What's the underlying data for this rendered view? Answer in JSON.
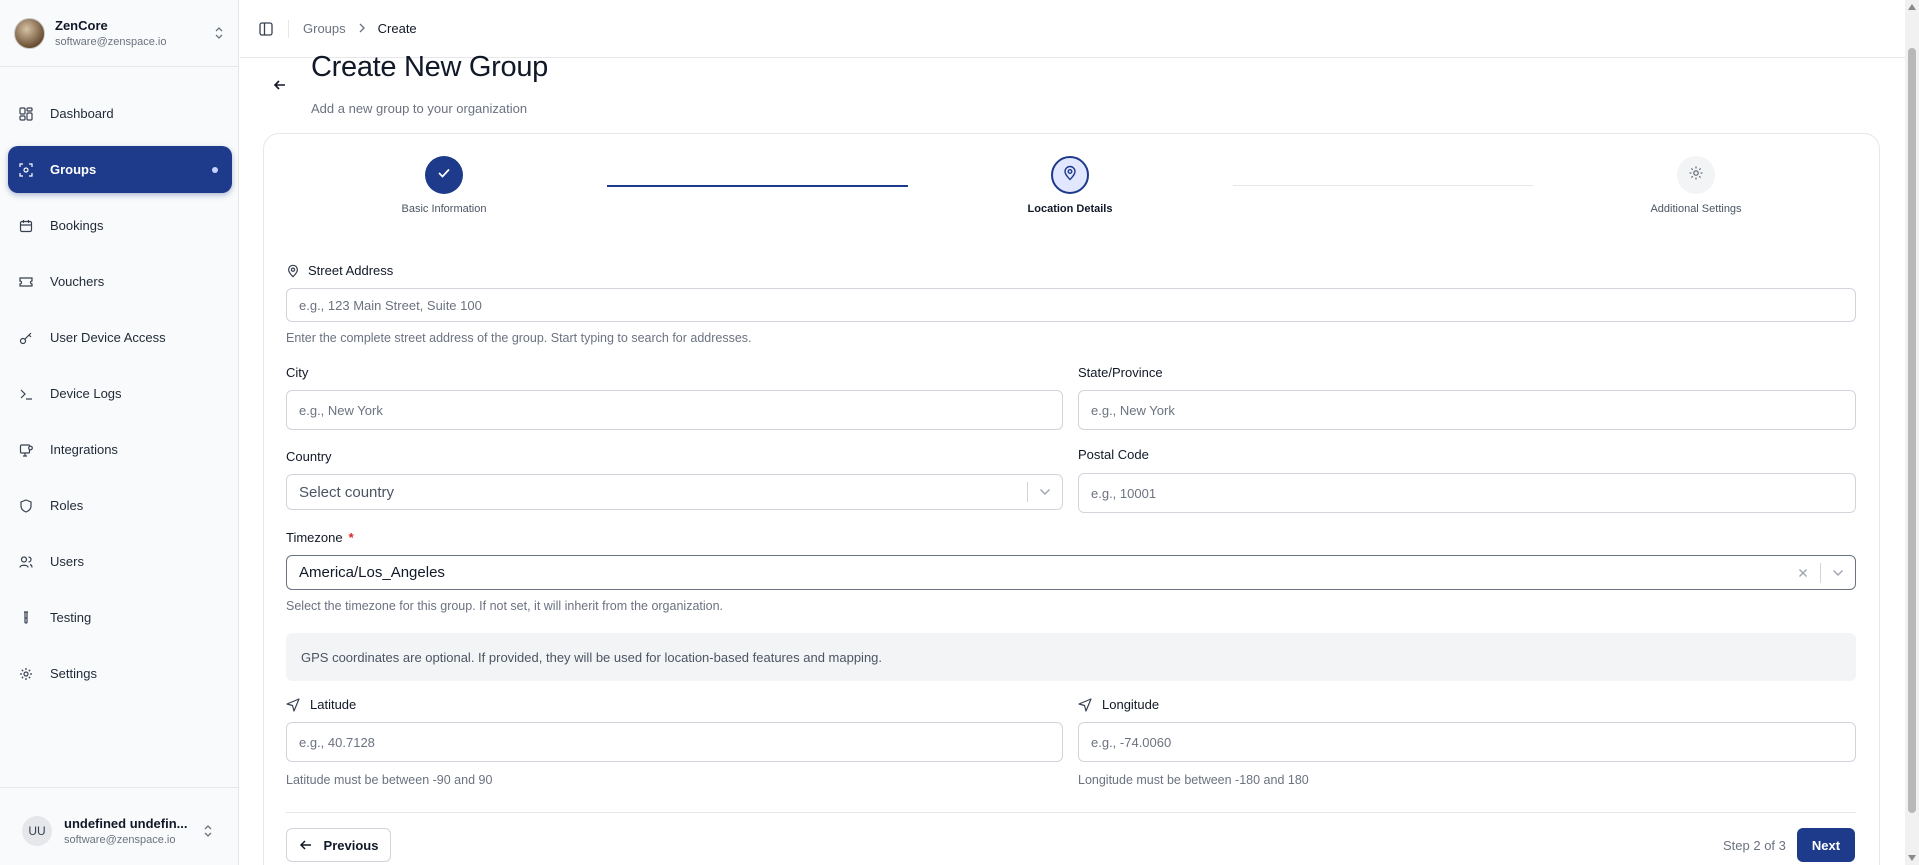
{
  "org": {
    "name": "ZenCore",
    "email": "software@zenspace.io"
  },
  "nav": [
    {
      "label": "Dashboard",
      "icon": "dashboard-icon"
    },
    {
      "label": "Groups",
      "icon": "groups-icon",
      "active": true
    },
    {
      "label": "Bookings",
      "icon": "calendar-icon"
    },
    {
      "label": "Vouchers",
      "icon": "ticket-icon"
    },
    {
      "label": "User Device Access",
      "icon": "key-icon"
    },
    {
      "label": "Device Logs",
      "icon": "terminal-icon"
    },
    {
      "label": "Integrations",
      "icon": "integrations-icon"
    },
    {
      "label": "Roles",
      "icon": "shield-icon"
    },
    {
      "label": "Users",
      "icon": "users-icon"
    },
    {
      "label": "Testing",
      "icon": "test-tube-icon"
    },
    {
      "label": "Settings",
      "icon": "gear-icon"
    }
  ],
  "user": {
    "initials": "UU",
    "name": "undefined undefin...",
    "email": "software@zenspace.io"
  },
  "breadcrumb": {
    "parent": "Groups",
    "current": "Create"
  },
  "header": {
    "title": "Create New Group",
    "subtitle": "Add a new group to your organization"
  },
  "stepper": {
    "steps": [
      {
        "label": "Basic Information",
        "state": "complete"
      },
      {
        "label": "Location Details",
        "state": "current"
      },
      {
        "label": "Additional Settings",
        "state": "upcoming"
      }
    ]
  },
  "form": {
    "street": {
      "label": "Street Address",
      "placeholder": "e.g., 123 Main Street, Suite 100",
      "help": "Enter the complete street address of the group. Start typing to search for addresses."
    },
    "city": {
      "label": "City",
      "placeholder": "e.g., New York"
    },
    "state": {
      "label": "State/Province",
      "placeholder": "e.g., New York"
    },
    "country": {
      "label": "Country",
      "placeholder": "Select country"
    },
    "postal": {
      "label": "Postal Code",
      "placeholder": "e.g., 10001"
    },
    "timezone": {
      "label": "Timezone",
      "required": "*",
      "value": "America/Los_Angeles",
      "help": "Select the timezone for this group. If not set, it will inherit from the organization."
    },
    "gps_note": "GPS coordinates are optional. If provided, they will be used for location-based features and mapping.",
    "latitude": {
      "label": "Latitude",
      "placeholder": "e.g., 40.7128",
      "help": "Latitude must be between -90 and 90"
    },
    "longitude": {
      "label": "Longitude",
      "placeholder": "e.g., -74.0060",
      "help": "Longitude must be between -180 and 180"
    }
  },
  "footer": {
    "previous": "Previous",
    "step_counter": "Step 2 of 3",
    "next": "Next"
  },
  "colors": {
    "primary": "#1e3a8a",
    "required": "#dc2626"
  }
}
